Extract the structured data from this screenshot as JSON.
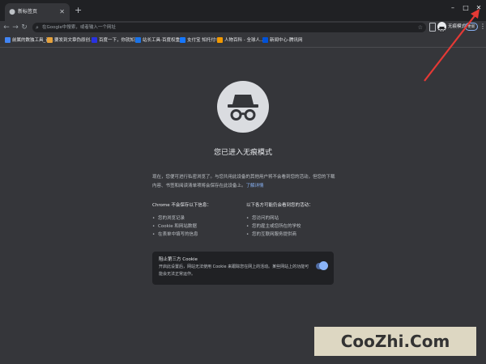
{
  "tab": {
    "title": "新标签页",
    "close_glyph": "✕"
  },
  "new_tab_glyph": "+",
  "window_controls": {
    "minimize": "–",
    "maximize": "□",
    "close": "✕"
  },
  "toolbar": {
    "back": "←",
    "forward": "→",
    "reload": "↻",
    "omnibox_placeholder": "在Google中搜索，或者输入一个网址",
    "incognito_label": "无痕模式",
    "update_label": "更新",
    "menu_glyph": "⋮"
  },
  "bookmarks": [
    {
      "label": "前属的数独工具_让...",
      "icon": "tool-icon",
      "color": "#4285f4"
    },
    {
      "label": "要发到文章伪原创...",
      "icon": "article-icon",
      "color": "#e6a23c"
    },
    {
      "label": "百度一下，你就知道",
      "icon": "baidu-icon",
      "color": "#2932e1"
    },
    {
      "label": "站长工具-百度权重...",
      "icon": "chart-icon",
      "color": "#1a73e8"
    },
    {
      "label": "支付宝 知托付!",
      "icon": "alipay-icon",
      "color": "#1677ff"
    },
    {
      "label": "人物百科 - 全球人...",
      "icon": "person-icon",
      "color": "#f29900"
    },
    {
      "label": "新闻中心-腾讯网",
      "icon": "news-icon",
      "color": "#0052d9"
    }
  ],
  "incognito_page": {
    "title": "您已进入无痕模式",
    "intro": "现在，您便可进行私密浏览了。与您共用此设备的其他用户将不会看到您的活动，但您的下载内容、书签和阅读清单项将会保存在此设备上。",
    "learn_more": "了解详情",
    "wont_save_heading": "Chrome 不会保存以下信息：",
    "wont_save_items": [
      "您的浏览记录",
      "Cookie 和网站数据",
      "在表单中填写的信息"
    ],
    "visible_heading": "以下各方可能仍会看到您的活动：",
    "visible_items": [
      "您访问的网站",
      "您的雇主或您所在的学校",
      "您的互联网服务提供商"
    ],
    "cookie_card": {
      "title": "阻止第三方 Cookie",
      "description": "开启此设置后，网站无法使用 Cookie 来跟踪您在网上的活动。某些网站上的功能可能会无法正常运作。",
      "toggle_on": true
    }
  },
  "watermark": "CooZhi.Com",
  "colors": {
    "accent": "#8ab4f8",
    "background": "#35363a",
    "chrome": "#202124",
    "annotation_arrow": "#e53935"
  }
}
